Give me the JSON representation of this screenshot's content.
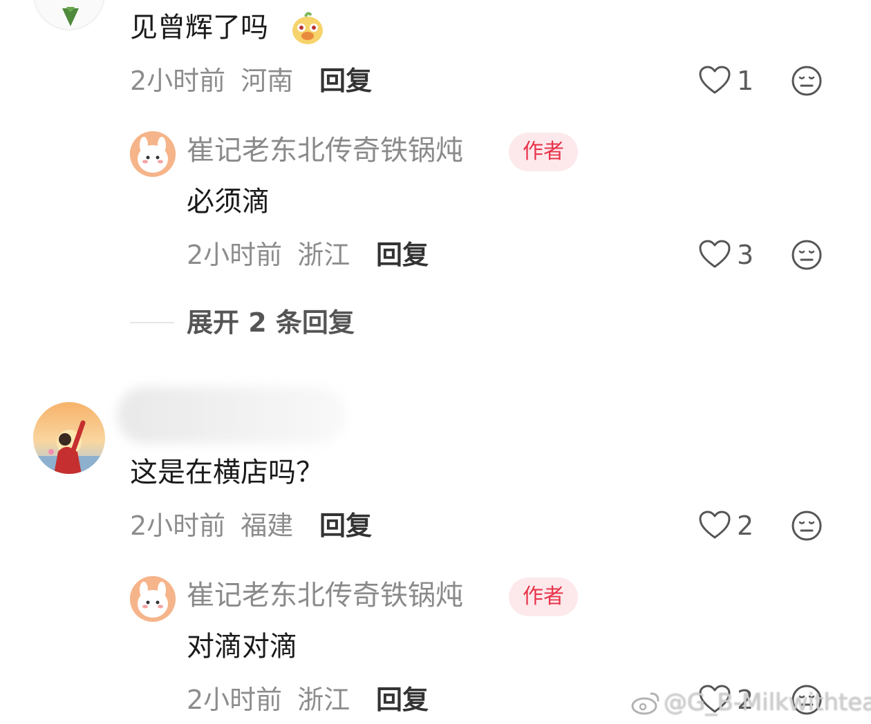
{
  "comments": [
    {
      "text": "见曾辉了吗",
      "time": "2小时前",
      "location": "河南",
      "reply_label": "回复",
      "likes": "1",
      "replies": [
        {
          "username": "崔记老东北传奇铁锅炖",
          "badge": "作者",
          "text": "必须滴",
          "time": "2小时前",
          "location": "浙江",
          "reply_label": "回复",
          "likes": "3"
        }
      ],
      "expand_label": "展开 2 条回复"
    },
    {
      "text": "这是在横店吗？",
      "time": "2小时前",
      "location": "福建",
      "reply_label": "回复",
      "likes": "2",
      "replies": [
        {
          "username": "崔记老东北传奇铁锅炖",
          "badge": "作者",
          "text": "对滴对滴",
          "time": "2小时前",
          "location": "浙江",
          "reply_label": "回复",
          "likes": "2"
        }
      ]
    }
  ],
  "watermark": "@G_B-Milkwithtea",
  "icons": {
    "like": "heart-outline-icon",
    "dislike": "meh-face-icon",
    "weibo": "weibo-logo"
  },
  "colors": {
    "author_badge_text": "#e8344a",
    "author_badge_bg": "#fde9ec",
    "meta_text": "#8c8c8c"
  }
}
